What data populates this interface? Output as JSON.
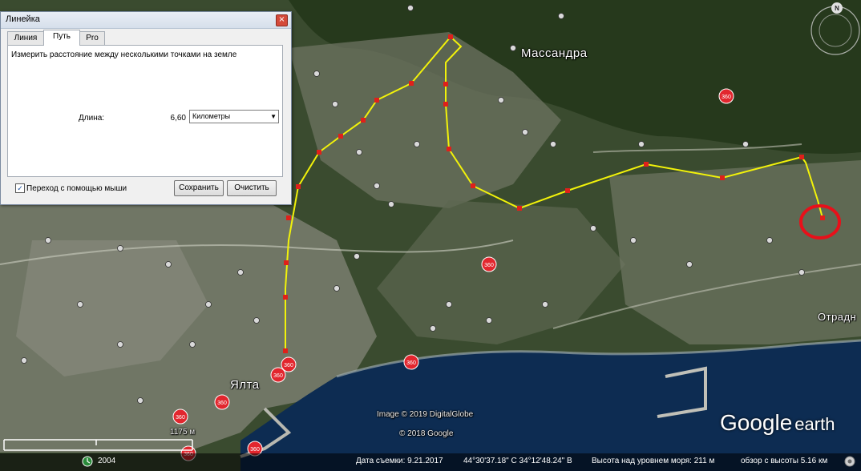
{
  "map": {
    "city_massandra": "Массандра",
    "city_yalta": "Ялта",
    "city_otradnoe": "Отрадн",
    "pano_label": "360",
    "credit_image": "Image © 2019 DigitalGlobe",
    "credit_google": "© 2018 Google",
    "scale_label": "1175 м",
    "logo_google": "Google",
    "logo_earth": "earth",
    "compass_label": "N",
    "colors": {
      "route": "#f2f20a",
      "route_point": "#e0201a",
      "highlight_circle": "#e8101a",
      "sea": "#0d2c52"
    }
  },
  "statusbar": {
    "year": "2004",
    "capture_date": "Дата съемки: 9.21.2017",
    "coordinates": "44°30'37.18\" С   34°12'48.24\" В",
    "elevation": "Высота над уровнем моря:   211 м",
    "eye_alt": "обзор с высоты    5.16 км"
  },
  "dialog": {
    "title": "Линейка",
    "close_icon": "close-icon",
    "tabs": [
      "Линия",
      "Путь",
      "Pro"
    ],
    "active_tab": "Путь",
    "description": "Измерить расстояние между несколькими точками на земле",
    "length_label": "Длина:",
    "length_value": "6,60",
    "unit_selected": "Километры",
    "mouse_nav_label": "Переход с помощью мыши",
    "mouse_nav_checked": true,
    "save_label": "Сохранить",
    "clear_label": "Очистить"
  }
}
